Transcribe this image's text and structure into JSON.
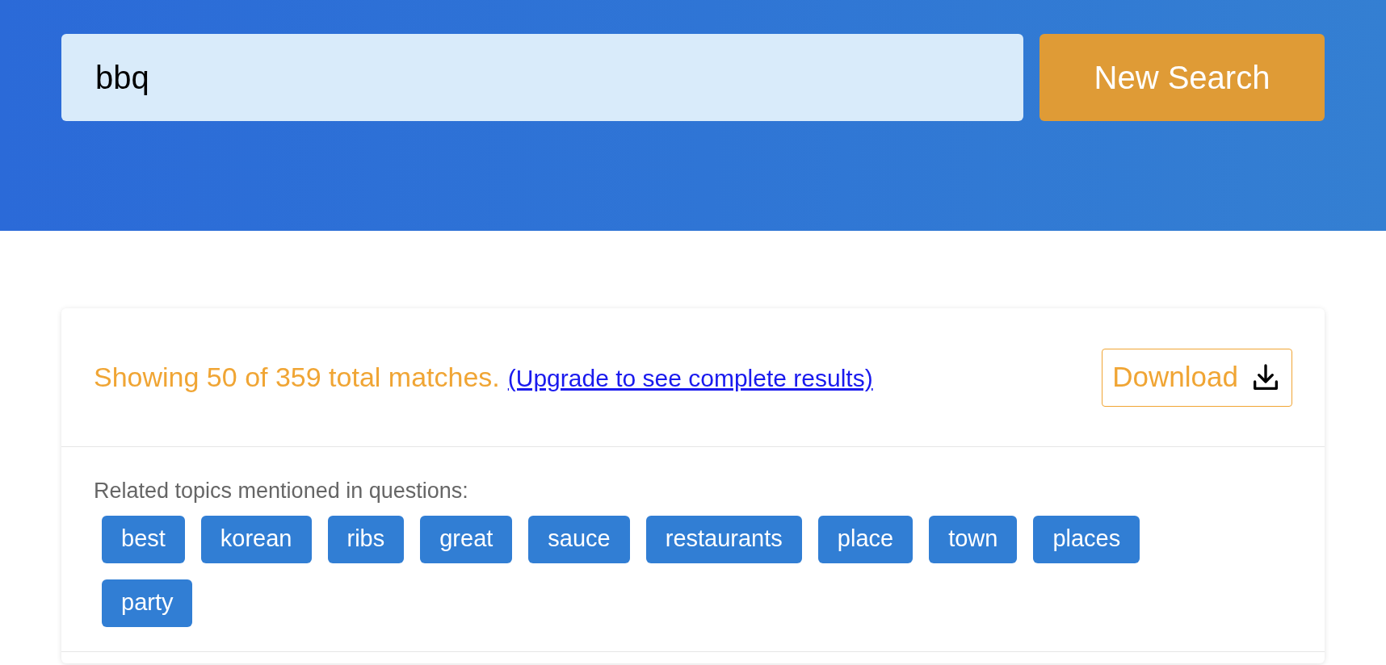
{
  "search": {
    "value": "bbq",
    "button": "New Search"
  },
  "results": {
    "summary": "Showing 50 of 359 total matches.",
    "upgrade_link": "(Upgrade to see complete results)",
    "download_button": "Download"
  },
  "related": {
    "label": "Related topics mentioned in questions:",
    "tags": [
      "best",
      "korean",
      "ribs",
      "great",
      "sauce",
      "restaurants",
      "place",
      "town",
      "places",
      "party"
    ]
  }
}
